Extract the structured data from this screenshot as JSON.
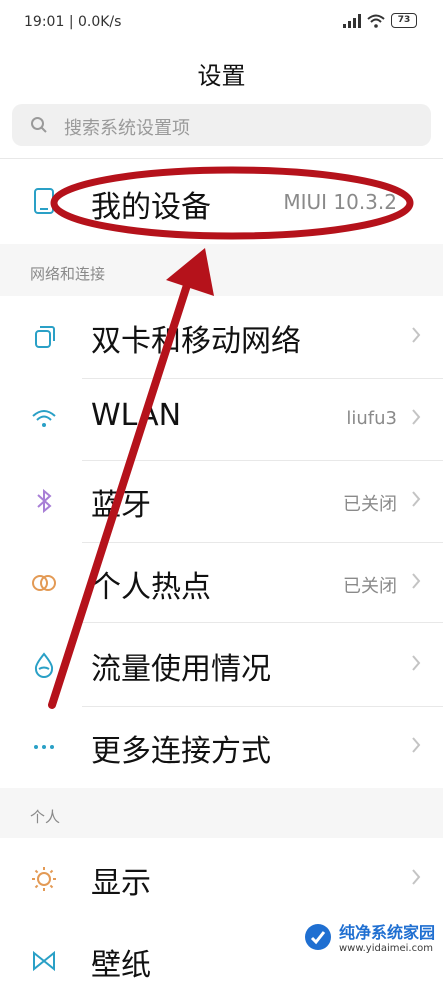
{
  "status_bar": {
    "time": "19:01",
    "speed": "0.0K/s",
    "battery": "73"
  },
  "page_title": "设置",
  "search": {
    "placeholder": "搜索系统设置项",
    "icon": "search-icon"
  },
  "device_row": {
    "label": "我的设备",
    "value": "MIUI 10.3.2",
    "icon": "phone-icon"
  },
  "sections": {
    "network": {
      "header": "网络和连接"
    },
    "personal": {
      "header": "个人"
    }
  },
  "network_items": [
    {
      "label": "双卡和移动网络",
      "value": "",
      "icon": "sim-card-icon"
    },
    {
      "label": "WLAN",
      "value": "liufu3",
      "icon": "wifi-icon"
    },
    {
      "label": "蓝牙",
      "value": "已关闭",
      "icon": "bluetooth-icon"
    },
    {
      "label": "个人热点",
      "value": "已关闭",
      "icon": "hotspot-icon"
    },
    {
      "label": "流量使用情况",
      "value": "",
      "icon": "data-usage-icon"
    },
    {
      "label": "更多连接方式",
      "value": "",
      "icon": "more-icon"
    }
  ],
  "personal_items": [
    {
      "label": "显示",
      "value": "",
      "icon": "sun-icon"
    },
    {
      "label": "壁纸",
      "value": "",
      "icon": "wallpaper-icon"
    }
  ],
  "colors": {
    "annotation": "#b5121b",
    "icon_blue": "#2aa0c6",
    "icon_purple": "#a87fd6",
    "icon_orange": "#e39a55"
  },
  "watermark": {
    "title": "纯净系统家园",
    "url": "www.yidaimei.com"
  }
}
